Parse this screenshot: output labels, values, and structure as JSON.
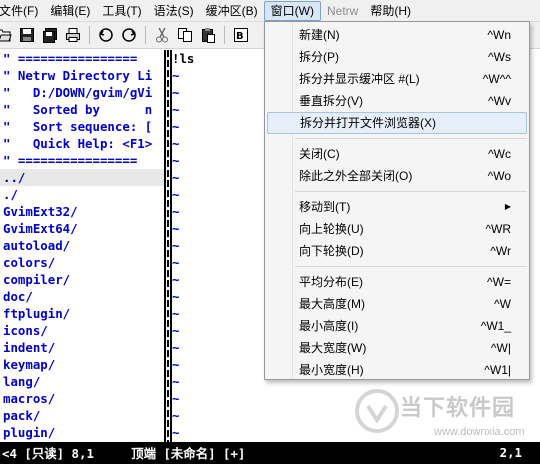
{
  "menubar": {
    "items": [
      {
        "label": "文件(F)"
      },
      {
        "label": "编辑(E)"
      },
      {
        "label": "工具(T)"
      },
      {
        "label": "语法(S)"
      },
      {
        "label": "缓冲区(B)"
      },
      {
        "label": "窗口(W)"
      },
      {
        "label": "Netrw"
      },
      {
        "label": "帮助(H)"
      }
    ]
  },
  "toolbar": {
    "icons": [
      "open-icon",
      "save-icon",
      "save-all-icon",
      "print-icon",
      "undo-icon",
      "redo-icon",
      "cut-icon",
      "copy-icon",
      "paste-icon",
      "find-replace-icon"
    ]
  },
  "editor": {
    "left_lines": [
      "\" ================",
      "\" Netrw Directory Li",
      "\"   D:/DOWN/gvim/gVi",
      "\"   Sorted by      n",
      "\"   Sort sequence: [",
      "\"   Quick Help: <F1>",
      "\" ================",
      "../",
      "./",
      "GvimExt32/",
      "GvimExt64/",
      "autoload/",
      "colors/",
      "compiler/",
      "doc/",
      "ftplugin/",
      "icons/",
      "indent/",
      "keymap/",
      "lang/",
      "macros/",
      "pack/",
      "plugin/"
    ],
    "command_text": "!ls",
    "tilde": "~"
  },
  "statusline": {
    "left": "<4 [只读] 8,1     顶端 [未命名] [+]",
    "right": "2,1"
  },
  "window_menu": {
    "items": [
      {
        "label": "新建(N)",
        "shortcut": "^Wn"
      },
      {
        "label": "拆分(P)",
        "shortcut": "^Ws"
      },
      {
        "label": "拆分并显示缓冲区 #(L)",
        "shortcut": "^W^^"
      },
      {
        "label": "垂直拆分(V)",
        "shortcut": "^Wv"
      },
      {
        "label": "拆分并打开文件浏览器(X)",
        "shortcut": ""
      },
      {
        "label": "关闭(C)",
        "shortcut": "^Wc"
      },
      {
        "label": "除此之外全部关闭(O)",
        "shortcut": "^Wo"
      },
      {
        "label": "移动到(T)",
        "shortcut": "▶"
      },
      {
        "label": "向上轮换(U)",
        "shortcut": "^WR"
      },
      {
        "label": "向下轮换(D)",
        "shortcut": "^Wr"
      },
      {
        "label": "平均分布(E)",
        "shortcut": "^W="
      },
      {
        "label": "最大高度(M)",
        "shortcut": "^W"
      },
      {
        "label": "最小高度(I)",
        "shortcut": "^W1_"
      },
      {
        "label": "最大宽度(W)",
        "shortcut": "^W|"
      },
      {
        "label": "最小宽度(H)",
        "shortcut": "^W1|"
      }
    ]
  },
  "watermark": {
    "title": "当下软件园",
    "url": "www.downxia.com"
  }
}
